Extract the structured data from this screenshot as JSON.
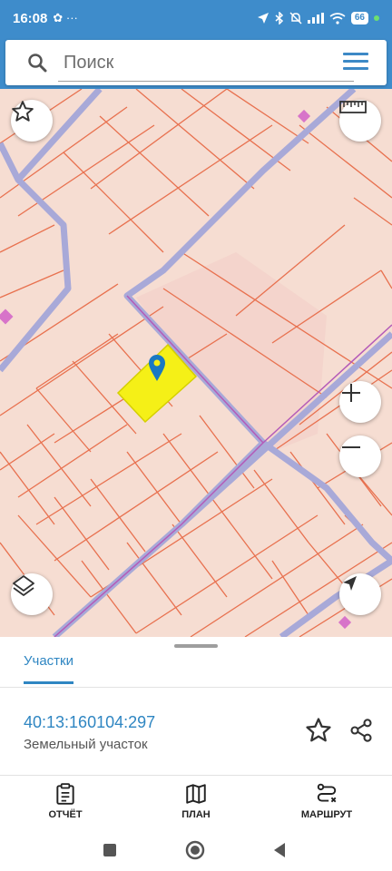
{
  "status_bar": {
    "time": "16:08",
    "left_icons": "✿ ···",
    "battery": "66",
    "accent": "#3e8ccb"
  },
  "search": {
    "placeholder": "Поиск"
  },
  "map": {
    "background": "#f6ddd2",
    "parcel_line_color": "#e8714f",
    "boundary_color": "#a8a9d8",
    "highlight_color": "#f5f017",
    "marker_color": "#1a78c2",
    "buttons": [
      "favorites-star-icon",
      "ruler-icon",
      "zoom-in-icon",
      "zoom-out-icon",
      "layers-icon",
      "navigation-arrow-icon"
    ]
  },
  "sheet": {
    "tab_label": "Участки",
    "parcel": {
      "number": "40:13:160104:297",
      "type": "Земельный участок"
    },
    "actions": [
      {
        "label": "ОТЧЁТ",
        "icon": "report-clipboard-icon"
      },
      {
        "label": "ПЛАН",
        "icon": "map-plan-icon"
      },
      {
        "label": "МАРШРУТ",
        "icon": "route-icon"
      }
    ]
  }
}
